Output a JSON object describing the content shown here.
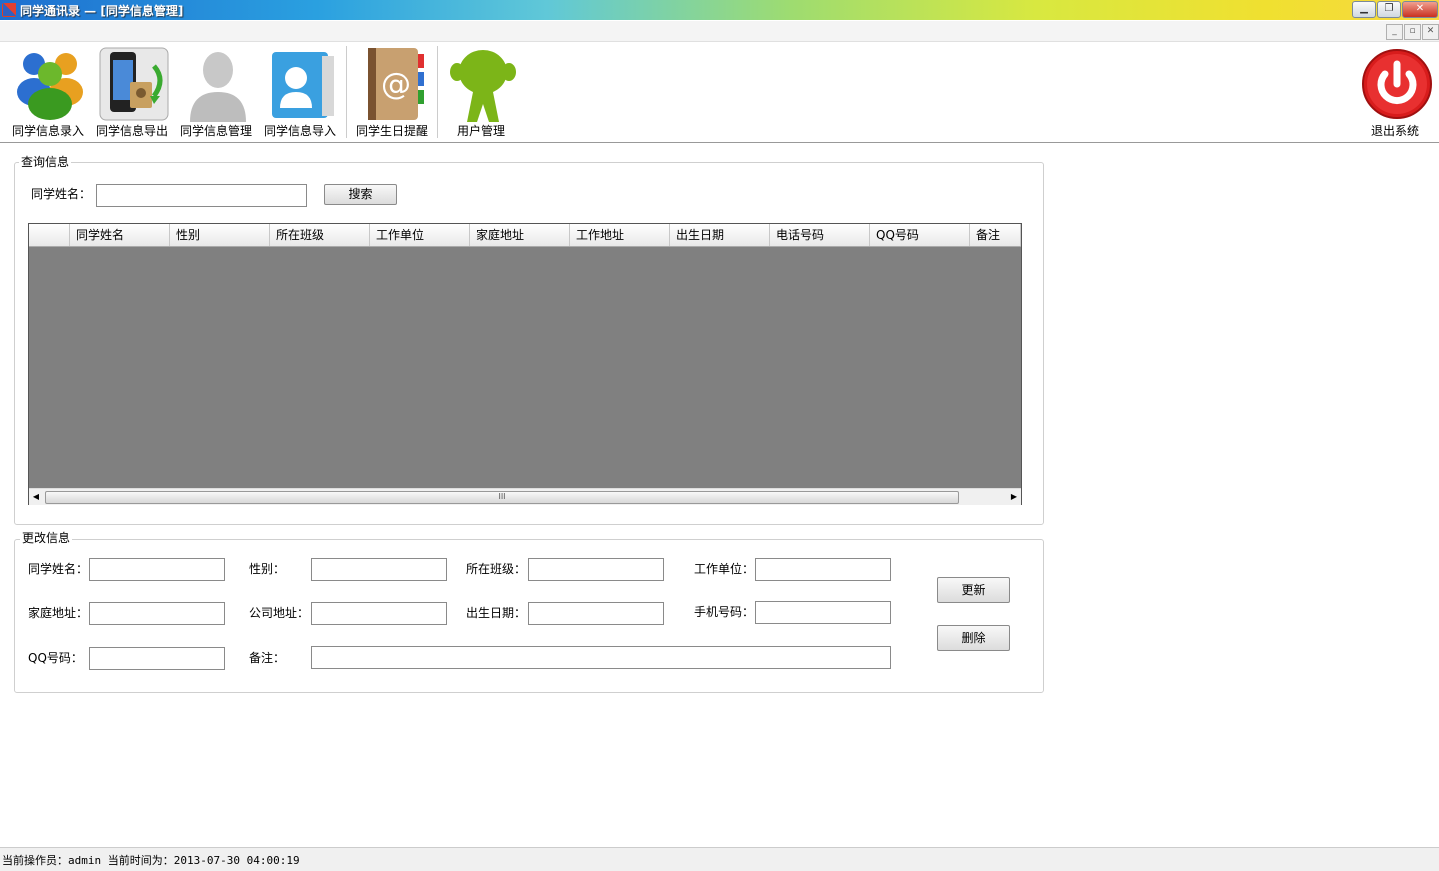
{
  "window": {
    "title": "同学通讯录 — [同学信息管理]",
    "minimize": "▁",
    "restore": "❐",
    "close": "✕"
  },
  "mdi": {
    "minimize": "_",
    "restore": "▫",
    "close": "✕"
  },
  "toolbar": {
    "items": [
      {
        "label": "同学信息录入",
        "icon": "users-icon"
      },
      {
        "label": "同学信息导出",
        "icon": "phone-export-icon"
      },
      {
        "label": "同学信息管理",
        "icon": "person-icon"
      },
      {
        "label": "同学信息导入",
        "icon": "contacts-import-icon"
      },
      {
        "label": "同学生日提醒",
        "icon": "address-book-icon"
      },
      {
        "label": "用户管理",
        "icon": "green-user-icon"
      }
    ],
    "exit_label": "退出系统"
  },
  "query": {
    "group_title": "查询信息",
    "name_label": "同学姓名：",
    "name_value": "",
    "search_label": "搜索"
  },
  "grid": {
    "columns": [
      "同学姓名",
      "性别",
      "所在班级",
      "工作单位",
      "家庭地址",
      "工作地址",
      "出生日期",
      "电话号码",
      "QQ号码",
      "备注"
    ],
    "scroll_thumb": "III",
    "left_arrow": "◀",
    "right_arrow": "▶"
  },
  "edit": {
    "group_title": "更改信息",
    "labels": {
      "name": "同学姓名：",
      "gender": "性别：",
      "class": "所在班级：",
      "work_unit": "工作单位：",
      "home_address": "家庭地址：",
      "company_address": "公司地址：",
      "birth_date": "出生日期：",
      "mobile": "手机号码：",
      "qq": "QQ号码：",
      "remark": "备注："
    },
    "update_label": "更新",
    "delete_label": "删除"
  },
  "status": {
    "text": "当前操作员：admin 当前时间为：2013-07-30 04:00:19"
  },
  "colors": {
    "grid_background": "#808080",
    "exit_button": "#d81c1c",
    "green_user": "#7cb518"
  }
}
